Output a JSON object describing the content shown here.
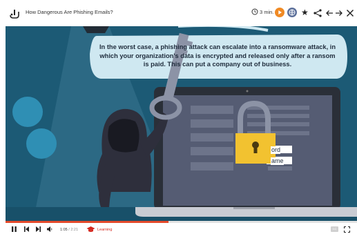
{
  "header": {
    "title": "How Dangerous Are Phishing Emails?",
    "duration": "3 min."
  },
  "video": {
    "caption": "In the worst case, a phishing attack can escalate into a ransomware attack, in which your organization's data is encrypted and released only after a ransom is paid. This can put a company out of business.",
    "laptop_fields": [
      "ord",
      "ame"
    ]
  },
  "player": {
    "current_time": "1:05",
    "total_time": "2:21",
    "progress_fraction": 0.46,
    "category": "Learning",
    "cc_label": "CC"
  },
  "colors": {
    "accent": "#e54b2b",
    "play_button": "#f08a24",
    "globe_button": "#5b6f9a",
    "category": "#d4271e",
    "video_background": "#1c5a75",
    "lock": "#f2c230"
  }
}
